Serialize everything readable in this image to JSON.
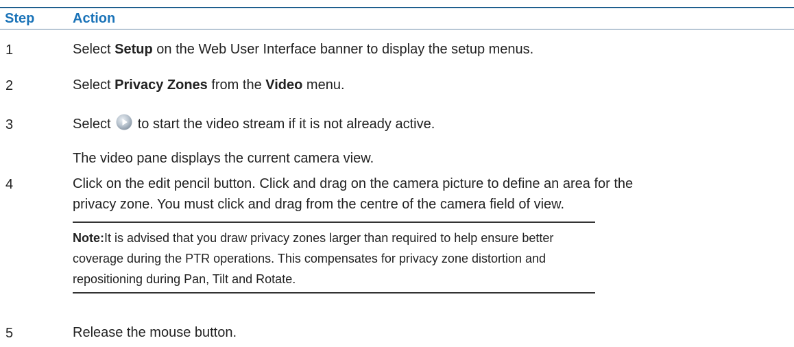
{
  "header": {
    "step": "Step",
    "action": "Action"
  },
  "steps": [
    {
      "num": "1",
      "parts": [
        "Select ",
        "Setup",
        " on the Web User Interface banner to display the setup menus."
      ]
    },
    {
      "num": "2",
      "parts": [
        "Select ",
        "Privacy Zones",
        " from the ",
        "Video",
        " menu."
      ]
    },
    {
      "num": "3",
      "before": "Select",
      "after": "to start the video stream if it is not already active.",
      "icon": "play-circle-icon",
      "sub": "The video pane displays the current camera view."
    },
    {
      "num": "4",
      "line1": "Click on the edit pencil button. Click and drag on the camera picture to define an area for the",
      "line2": "privacy zone. You must click and drag from the centre of the camera field of view."
    },
    {
      "num": "5",
      "text": "Release the mouse button."
    }
  ],
  "note": {
    "label": "Note:",
    "text": "It is advised that you draw privacy zones larger than required to help ensure better coverage during the PTR operations. This compensates for privacy zone distortion and repositioning during Pan, Tilt and Rotate."
  },
  "colors": {
    "header_text": "#1a73b8",
    "rule": "#1f5f8e"
  }
}
